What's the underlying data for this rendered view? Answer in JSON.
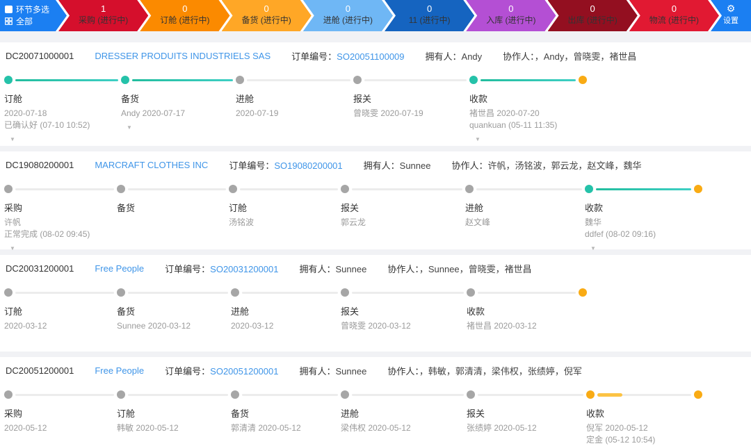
{
  "colors": {
    "bar_blue": "#1b7ff2",
    "chevrons": [
      "#d50f2c",
      "#fb8a00",
      "#ffa726",
      "#6fb7f5",
      "#1564c0",
      "#b44fd4",
      "#930f20",
      "#e11932"
    ],
    "link_blue": "#3f95e8",
    "timeline_teal": "#25c2a9",
    "timeline_orange": "#f9ab14",
    "timeline_gray": "#a6a6a6"
  },
  "topbar": {
    "multi_select": "环节多选",
    "all": "全部",
    "settings": "设置",
    "stages": [
      {
        "count": "1",
        "label": "采购 (进行中)"
      },
      {
        "count": "0",
        "label": "订舱 (进行中)"
      },
      {
        "count": "0",
        "label": "备货 (进行中)"
      },
      {
        "count": "0",
        "label": "进舱 (进行中)"
      },
      {
        "count": "0",
        "label": "11 (进行中)"
      },
      {
        "count": "0",
        "label": "入库 (进行中)"
      },
      {
        "count": "0",
        "label": "出库 (进行中)"
      },
      {
        "count": "0",
        "label": "物流 (进行中)"
      }
    ]
  },
  "labels": {
    "order_no": "订单编号：",
    "owner": "拥有人：",
    "collab": "协作人："
  },
  "orders": [
    {
      "id": "DC20071000001",
      "customer": "DRESSER PRODUITS INDUSTRIELS SAS",
      "order_no": "SO20051100009",
      "owner": "Andy",
      "collaborators": "，Andy，曾晓雯，褚世昌",
      "stages": [
        {
          "name": "订舱",
          "line1": "2020-07-18",
          "line2": "已确认好 (07-10 10:52)"
        },
        {
          "name": "备货",
          "line1": "Andy 2020-07-17"
        },
        {
          "name": "进舱",
          "line1": "2020-07-19"
        },
        {
          "name": "报关",
          "line1": "曾晓雯 2020-07-19"
        },
        {
          "name": "收款",
          "line1": "褚世昌 2020-07-20",
          "line2": "quankuan (05-11 11:35)"
        }
      ]
    },
    {
      "id": "DC19080200001",
      "customer": "MARCRAFT CLOTHES INC",
      "order_no": "SO19080200001",
      "owner": "Sunnee",
      "collaborators": "许帆，汤铭波，郭云龙，赵文峰，魏华",
      "stages": [
        {
          "name": "采购",
          "line1": "许帆",
          "line2": "正常完成 (08-02 09:45)"
        },
        {
          "name": "备货",
          "line1": ""
        },
        {
          "name": "订舱",
          "line1": "汤铭波"
        },
        {
          "name": "报关",
          "line1": "郭云龙"
        },
        {
          "name": "进舱",
          "line1": "赵文峰"
        },
        {
          "name": "收款",
          "line1": "魏华",
          "line2": "ddfef (08-02 09:16)"
        }
      ]
    },
    {
      "id": "DC20031200001",
      "customer": "Free People",
      "order_no": "SO20031200001",
      "owner": "Sunnee",
      "collaborators": "，Sunnee，曾晓雯，褚世昌",
      "stages": [
        {
          "name": "订舱",
          "line1": "2020-03-12"
        },
        {
          "name": "备货",
          "line1": "Sunnee 2020-03-12"
        },
        {
          "name": "进舱",
          "line1": "2020-03-12"
        },
        {
          "name": "报关",
          "line1": "曾晓雯 2020-03-12"
        },
        {
          "name": "收款",
          "line1": "褚世昌 2020-03-12"
        }
      ]
    },
    {
      "id": "DC20051200001",
      "customer": "Free People",
      "order_no": "SO20051200001",
      "owner": "Sunnee",
      "collaborators": "，韩敏，郭清清，梁伟权，张绩婷，倪军",
      "stages": [
        {
          "name": "采购",
          "line1": "2020-05-12"
        },
        {
          "name": "订舱",
          "line1": "韩敏 2020-05-12"
        },
        {
          "name": "备货",
          "line1": "郭清清 2020-05-12"
        },
        {
          "name": "进舱",
          "line1": "梁伟权 2020-05-12"
        },
        {
          "name": "报关",
          "line1": "张绩婷 2020-05-12"
        },
        {
          "name": "收款",
          "line1": "倪军 2020-05-12",
          "line2": "定金 (05-12 10:54)"
        }
      ]
    }
  ]
}
